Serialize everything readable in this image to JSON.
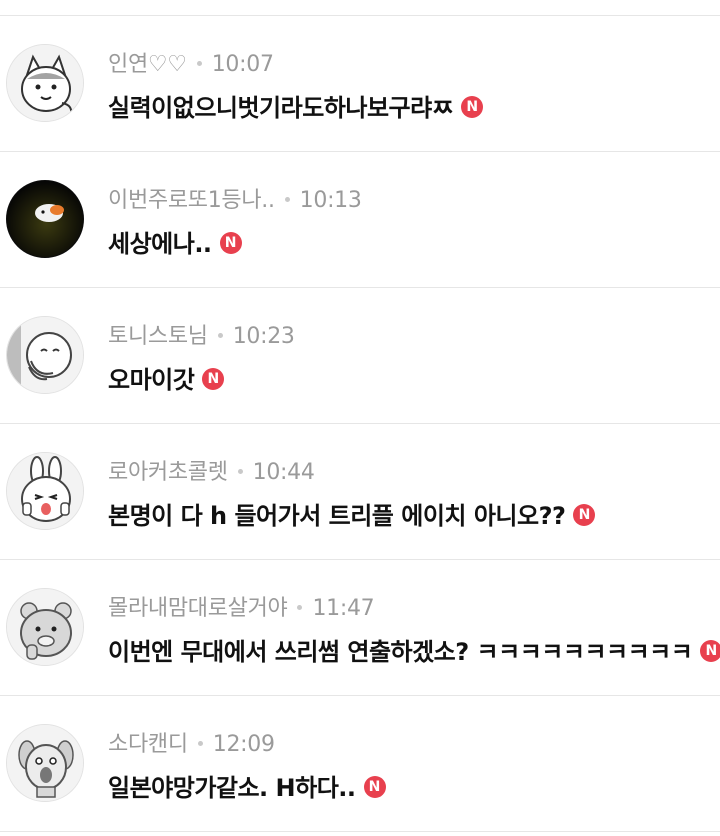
{
  "new_badge_label": "N",
  "comments": [
    {
      "author": "인연♡♡",
      "time": "10:07",
      "text": "실력이없으니벗기라도하나보구랴ㅉ",
      "avatar_icon": "cat-character-avatar-icon"
    },
    {
      "author": "이번주로또1등나..",
      "time": "10:13",
      "text": "세상에나..",
      "avatar_icon": "dark-photo-avatar-icon"
    },
    {
      "author": "토니스토님",
      "time": "10:23",
      "text": "오마이갓",
      "avatar_icon": "smiling-character-avatar-icon"
    },
    {
      "author": "로아커초콜렛",
      "time": "10:44",
      "text": "본명이 다 h 들어가서 트리플 에이치 아니오??",
      "avatar_icon": "bunny-character-avatar-icon"
    },
    {
      "author": "몰라내맘대로살거야",
      "time": "11:47",
      "text": "이번엔 무대에서 쓰리썸 연출하겠소? ㅋㅋㅋㅋㅋㅋㅋㅋㅋㅋ",
      "avatar_icon": "bear-character-avatar-icon"
    },
    {
      "author": "소다캔디",
      "time": "12:09",
      "text": "일본야망가같소. H하다..",
      "avatar_icon": "dog-character-avatar-icon"
    }
  ],
  "colors": {
    "badge": "#e8404e",
    "meta_text": "#9a9a9a",
    "comment_text": "#111111",
    "divider": "#e6e6e6"
  }
}
